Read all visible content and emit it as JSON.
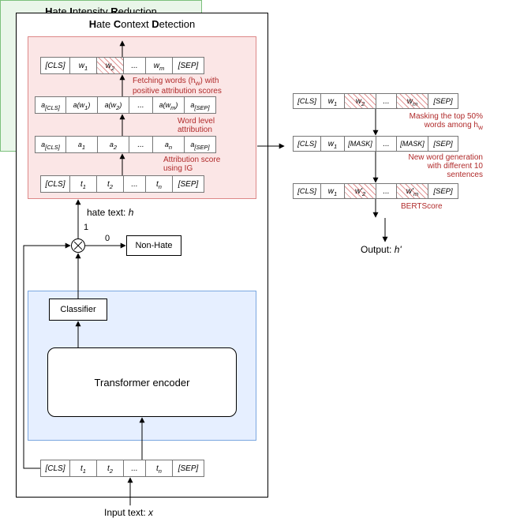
{
  "hcd": {
    "title_H": "H",
    "title_ate": "ate ",
    "title_C": "C",
    "title_ontext": "ontext ",
    "title_D": "D",
    "title_etection": "etection",
    "row1": {
      "c0": "[CLS]",
      "c1": "w",
      "s1": "1",
      "c2": "w",
      "s2": "2",
      "dots": "...",
      "cm": "w",
      "sm": "m",
      "sep": "[SEP]"
    },
    "row2": {
      "c0": "a",
      "sub0": "[CLS]",
      "c1": "a(w",
      "s1": "1",
      "p1": ")",
      "c2": "a(w",
      "s2": "2",
      "p2": ")",
      "dots": "...",
      "cm": "a(w",
      "sm": "m",
      "pm": ")",
      "sep": "a",
      "subsep": "[SEP]"
    },
    "row3": {
      "c0": "a",
      "sub0": "[CLS]",
      "c1": "a",
      "s1": "1",
      "c2": "a",
      "s2": "2",
      "dots": "...",
      "cn": "a",
      "sn": "n",
      "sep": "a",
      "subsep": "[SEP]"
    },
    "row4": {
      "c0": "[CLS]",
      "c1": "t",
      "s1": "1",
      "c2": "t",
      "s2": "2",
      "dots": "...",
      "cn": "t",
      "sn": "n",
      "sep": "[SEP]"
    },
    "note_fetch_a": "Fetching words (h",
    "note_fetch_sub": "w",
    "note_fetch_b": ") with",
    "note_fetch_c": "positive attribution scores",
    "note_wordlevel_a": "Word level",
    "note_wordlevel_b": "attribution",
    "note_ig_a": "Attribution score",
    "note_ig_b": "using IG",
    "hate_text": "hate text:  ",
    "hate_text_h": "h",
    "one": "1",
    "zero": "0",
    "nonhate": "Non-Hate",
    "classifier": "Classifier",
    "encoder": "Transformer encoder",
    "bottom_row": {
      "c0": "[CLS]",
      "c1": "t",
      "s1": "1",
      "c2": "t",
      "s2": "2",
      "dots": "...",
      "cn": "t",
      "sn": "n",
      "sep": "[SEP]"
    },
    "input_text": "Input text:  ",
    "input_text_x": "x"
  },
  "hir": {
    "title_H": "H",
    "title_ate": "ate ",
    "title_I": "I",
    "title_ntensity": "ntensity ",
    "title_R": "R",
    "title_eduction": "eduction",
    "row1": {
      "c0": "[CLS]",
      "c1": "w",
      "s1": "1",
      "c2": "w",
      "s2": "2",
      "dots": "...",
      "cm": "w",
      "sm": "m",
      "sep": "[SEP]"
    },
    "row2": {
      "c0": "[CLS]",
      "c1": "w",
      "s1": "1",
      "mask2": "[MASK]",
      "dots": "...",
      "maskm": "[MASK]",
      "sep": "[SEP]"
    },
    "row3": {
      "c0": "[CLS]",
      "c1": "w",
      "s1": "1",
      "c2": "w'",
      "s2": "2",
      "dots": "...",
      "cm": "w'",
      "sm": "m",
      "sep": "[SEP]"
    },
    "note_mask_a": "Masking the top 50%",
    "note_mask_b": "words among h",
    "note_mask_sub": "w",
    "note_gen_a": "New word generation",
    "note_gen_b": "with different 10",
    "note_gen_c": "sentences",
    "note_bert": "BERTScore",
    "output": "Output:  ",
    "output_h": "h'"
  }
}
